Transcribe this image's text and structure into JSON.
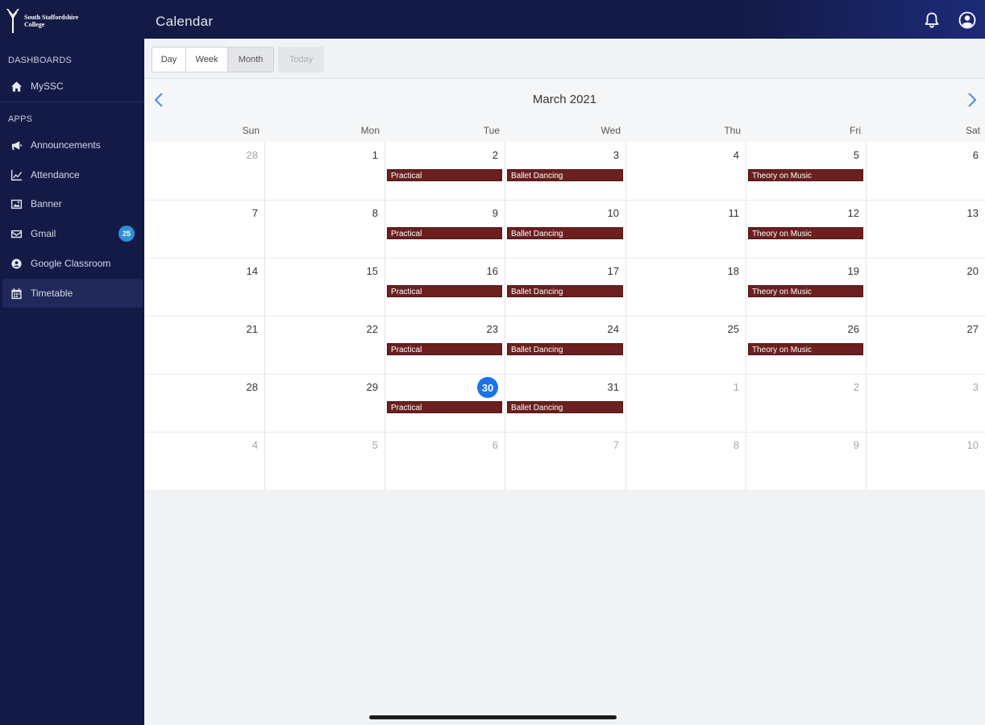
{
  "app": {
    "logo_text": "South Staffordshire College",
    "page_title": "Calendar"
  },
  "sidebar": {
    "sections": [
      {
        "label": "DASHBOARDS"
      },
      {
        "label": "APPS"
      }
    ],
    "items": [
      {
        "label": "MySSC",
        "icon": "home-icon"
      },
      {
        "label": "Announcements",
        "icon": "megaphone-icon"
      },
      {
        "label": "Attendance",
        "icon": "chart-line-icon"
      },
      {
        "label": "Banner",
        "icon": "image-icon"
      },
      {
        "label": "Gmail",
        "icon": "mail-icon",
        "badge": "25"
      },
      {
        "label": "Google Classroom",
        "icon": "classroom-icon"
      },
      {
        "label": "Timetable",
        "icon": "calendar-icon",
        "active": true
      }
    ]
  },
  "toolbar": {
    "views": [
      {
        "label": "Day"
      },
      {
        "label": "Week"
      },
      {
        "label": "Month",
        "active": true
      }
    ],
    "today_label": "Today"
  },
  "calendar": {
    "month_title": "March 2021",
    "weekdays": [
      "Sun",
      "Mon",
      "Tue",
      "Wed",
      "Thu",
      "Fri",
      "Sat"
    ],
    "today": "30",
    "weeks": [
      {
        "days": [
          {
            "n": "28",
            "m": true
          },
          {
            "n": "1"
          },
          {
            "n": "2"
          },
          {
            "n": "3"
          },
          {
            "n": "4"
          },
          {
            "n": "5"
          },
          {
            "n": "6"
          }
        ]
      },
      {
        "days": [
          {
            "n": "7"
          },
          {
            "n": "8"
          },
          {
            "n": "9"
          },
          {
            "n": "10"
          },
          {
            "n": "11"
          },
          {
            "n": "12"
          },
          {
            "n": "13"
          }
        ]
      },
      {
        "days": [
          {
            "n": "14"
          },
          {
            "n": "15"
          },
          {
            "n": "16"
          },
          {
            "n": "17"
          },
          {
            "n": "18"
          },
          {
            "n": "19"
          },
          {
            "n": "20"
          }
        ]
      },
      {
        "days": [
          {
            "n": "21"
          },
          {
            "n": "22"
          },
          {
            "n": "23"
          },
          {
            "n": "24"
          },
          {
            "n": "25"
          },
          {
            "n": "26"
          },
          {
            "n": "27"
          }
        ]
      },
      {
        "days": [
          {
            "n": "28"
          },
          {
            "n": "29"
          },
          {
            "n": "30"
          },
          {
            "n": "31"
          },
          {
            "n": "1",
            "m": true
          },
          {
            "n": "2",
            "m": true
          },
          {
            "n": "3",
            "m": true
          }
        ]
      },
      {
        "days": [
          {
            "n": "4",
            "m": true
          },
          {
            "n": "5",
            "m": true
          },
          {
            "n": "6",
            "m": true
          },
          {
            "n": "7",
            "m": true
          },
          {
            "n": "8",
            "m": true
          },
          {
            "n": "9",
            "m": true
          },
          {
            "n": "10",
            "m": true
          }
        ]
      }
    ],
    "events": [
      {
        "week": 0,
        "day": 2,
        "title": "Practical"
      },
      {
        "week": 0,
        "day": 3,
        "title": "Ballet Dancing"
      },
      {
        "week": 0,
        "day": 5,
        "title": "Theory on Music"
      },
      {
        "week": 1,
        "day": 2,
        "title": "Practical"
      },
      {
        "week": 1,
        "day": 3,
        "title": "Ballet Dancing"
      },
      {
        "week": 1,
        "day": 5,
        "title": "Theory on Music"
      },
      {
        "week": 2,
        "day": 2,
        "title": "Practical"
      },
      {
        "week": 2,
        "day": 3,
        "title": "Ballet Dancing"
      },
      {
        "week": 2,
        "day": 5,
        "title": "Theory on Music"
      },
      {
        "week": 3,
        "day": 2,
        "title": "Practical"
      },
      {
        "week": 3,
        "day": 3,
        "title": "Ballet Dancing"
      },
      {
        "week": 3,
        "day": 5,
        "title": "Theory on Music"
      },
      {
        "week": 4,
        "day": 2,
        "title": "Practical"
      },
      {
        "week": 4,
        "day": 3,
        "title": "Ballet Dancing"
      }
    ],
    "event_color": "#6b1f1f",
    "today_color": "#1a73e8"
  }
}
